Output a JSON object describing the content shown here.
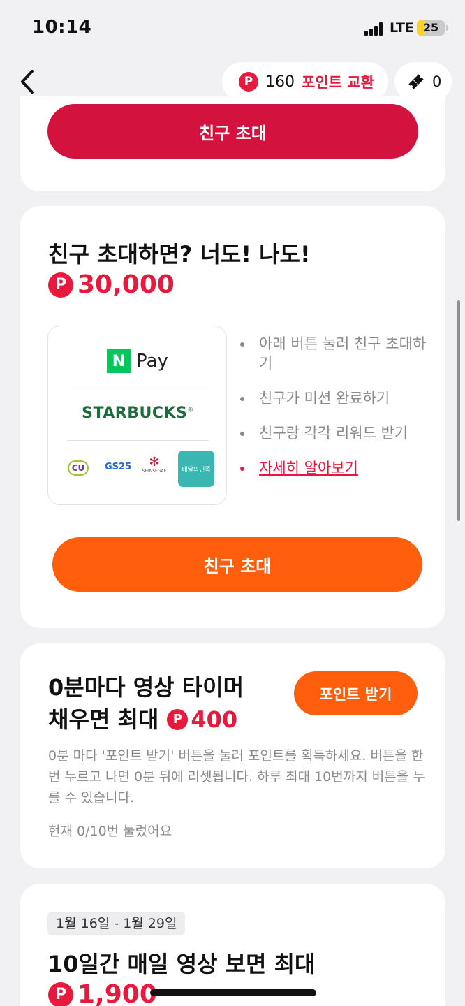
{
  "status_bar": {
    "time": "10:14",
    "network": "LTE",
    "battery": "25",
    "battery_level": 0.25
  },
  "header": {
    "points_count": "160",
    "points_exchange_label": "포인트 교환",
    "ticket_count": "0",
    "icons": {
      "back": "chevron-left-icon",
      "points": "point-coin-icon",
      "ticket": "ticket-icon"
    }
  },
  "top_card": {
    "invite_button": "친구 초대"
  },
  "invite_card": {
    "title": "친구 초대하면? 너도! 나도!",
    "amount": "30,000",
    "brands": {
      "npay_n": "N",
      "npay_text": "Pay",
      "starbucks": "STARBUCKS",
      "starbucks_mark": "®",
      "cu": "CU",
      "gs25": "GS25",
      "shinsegae": "SHINSEGAE",
      "baemin": "배달의민족"
    },
    "steps": [
      "아래 버튼 눌러 친구 초대하기",
      "친구가 미션 완료하기",
      "친구랑 각각 리워드 받기",
      "자세히 알아보기"
    ],
    "invite_button": "친구 초대"
  },
  "timer_card": {
    "title_line1": "0분마다 영상 타이머",
    "title_line2": "채우면 최대",
    "reward": "400",
    "get_points_button": "포인트 받기",
    "description": "0분 마다 '포인트 받기' 버튼을 눌러 포인트를 획득하세요. 버튼을 한번 누르고 나면 0분 뒤에 리셋됩니다. 하루 최대 10번까지 버튼을 누를 수 있습니다.",
    "status": "현재 0/10번 눌렀어요"
  },
  "daily_card": {
    "date_range": "1월 16일 - 1월 29일",
    "title": "10일간 매일 영상 보면 최대",
    "amount": "1,900"
  },
  "point_symbol": "P",
  "colors": {
    "red": "#e8193c",
    "button_red": "#d3133d",
    "orange": "#ff5e0d",
    "npay_green": "#03c75a",
    "starbucks_green": "#1e6b3b"
  }
}
